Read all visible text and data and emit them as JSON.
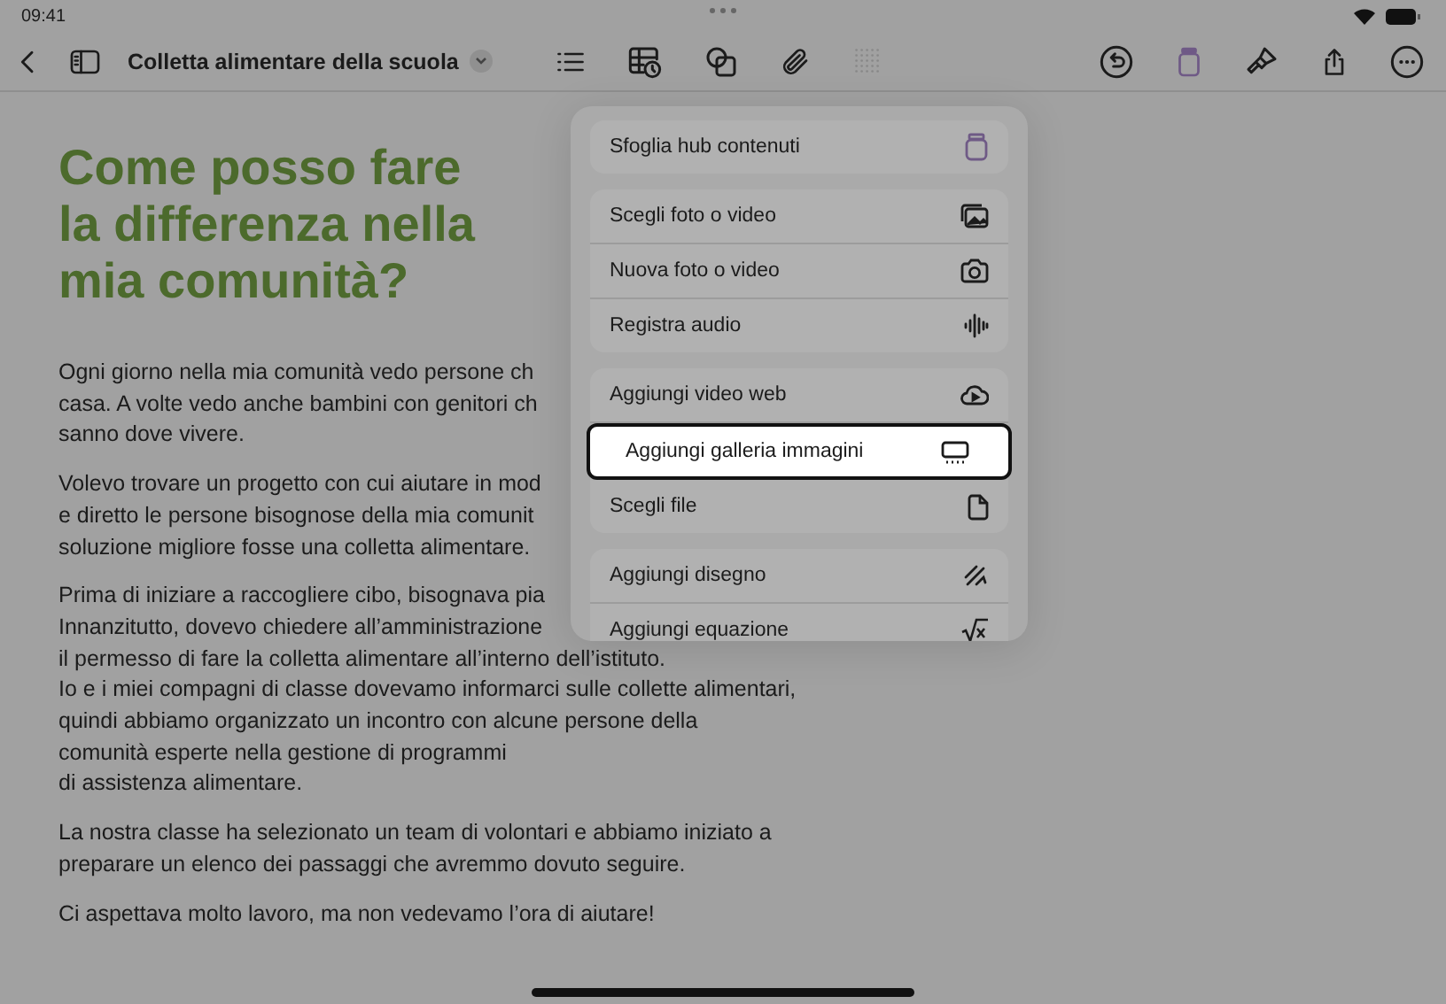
{
  "status_bar": {
    "time": "09:41"
  },
  "toolbar": {
    "title": "Colletta alimentare della scuola"
  },
  "document": {
    "title_lines": [
      "Come posso fare",
      "la differenza nella",
      "mia comunità?"
    ],
    "paragraphs": [
      [
        "Ogni giorno nella mia comunità vedo persone ch",
        "casa. A volte vedo anche bambini con genitori ch",
        "sanno dove vivere."
      ],
      [
        "Volevo trovare un progetto con cui aiutare in mod",
        "e diretto le persone bisognose della mia comunit",
        "soluzione migliore fosse una colletta alimentare."
      ],
      [
        "Prima di iniziare a raccogliere cibo, bisognava pia",
        "Innanzitutto, dovevo chiedere all’amministrazione",
        "il permesso di fare la colletta alimentare all’interno dell’istituto.",
        "Io e i miei compagni di classe dovevamo informarci sulle collette alimentari,",
        "quindi abbiamo organizzato un incontro con alcune persone della",
        "comunità esperte nella gestione di programmi",
        "di assistenza alimentare."
      ],
      [
        "La nostra classe ha selezionato un team di volontari e abbiamo iniziato a",
        "preparare un elenco dei passaggi che avremmo dovuto seguire."
      ],
      [
        "Ci aspettava molto lavoro, ma non vedevamo l’ora di aiutare!"
      ]
    ]
  },
  "insert_menu": {
    "groups": [
      [
        {
          "label": "Sfoglia hub contenuti",
          "kind": "hub",
          "selected": false
        }
      ],
      [
        {
          "label": "Scegli foto o video",
          "kind": "photos",
          "selected": false
        },
        {
          "label": "Nuova foto o video",
          "kind": "camera",
          "selected": false
        },
        {
          "label": "Registra audio",
          "kind": "audio",
          "selected": false
        }
      ],
      [
        {
          "label": "Aggiungi video web",
          "kind": "cloud",
          "selected": false
        },
        {
          "label": "Aggiungi galleria immagini",
          "kind": "gallery",
          "selected": true
        },
        {
          "label": "Scegli file",
          "kind": "file",
          "selected": false
        }
      ],
      [
        {
          "label": "Aggiungi disegno",
          "kind": "drawing",
          "selected": false
        },
        {
          "label": "Aggiungi equazione",
          "kind": "equation",
          "selected": false
        }
      ]
    ]
  }
}
